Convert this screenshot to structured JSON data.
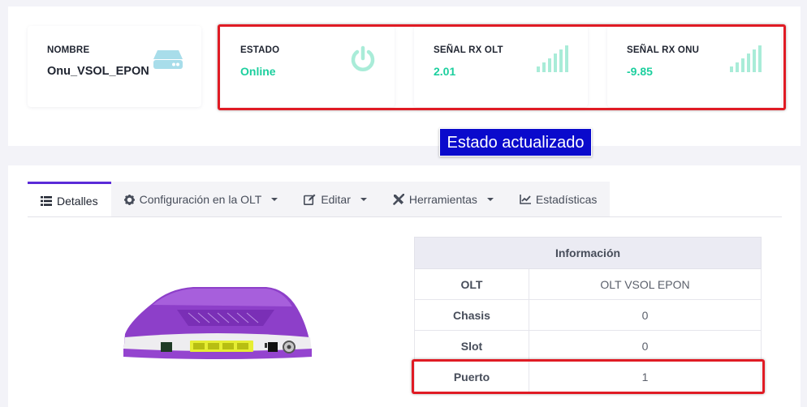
{
  "cards": {
    "nombre": {
      "label": "NOMBRE",
      "value": "Onu_VSOL_EPON",
      "icon": "router-icon"
    },
    "estado": {
      "label": "ESTADO",
      "value": "Online",
      "icon": "power-icon"
    },
    "senal_olt": {
      "label": "SEÑAL RX OLT",
      "value": "2.01",
      "icon": "signal-bars-icon"
    },
    "senal_onu": {
      "label": "SEÑAL RX ONU",
      "value": "-9.85",
      "icon": "signal-bars-icon"
    }
  },
  "toast": "Estado actualizado",
  "tabs": [
    {
      "label": "Detalles",
      "icon": "list-icon",
      "active": true
    },
    {
      "label": "Configuración en la OLT",
      "icon": "gear-icon",
      "dropdown": true
    },
    {
      "label": "Editar",
      "icon": "edit-icon",
      "dropdown": true
    },
    {
      "label": "Herramientas",
      "icon": "tools-icon",
      "dropdown": true
    },
    {
      "label": "Estadísticas",
      "icon": "chart-line-icon"
    }
  ],
  "info_table": {
    "header": "Información",
    "rows": [
      {
        "key": "OLT",
        "value": "OLT VSOL EPON"
      },
      {
        "key": "Chasis",
        "value": "0"
      },
      {
        "key": "Slot",
        "value": "0"
      },
      {
        "key": "Puerto",
        "value": "1"
      }
    ]
  },
  "colors": {
    "accent": "#5b2bd8",
    "success": "#1ccf9e",
    "highlight": "#e01b24",
    "toast_bg": "#0a0acc"
  }
}
